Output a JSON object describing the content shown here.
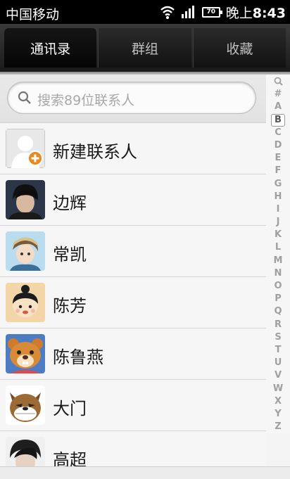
{
  "status_bar": {
    "carrier": "中国移动",
    "battery": "70",
    "time_prefix": "晚上",
    "time": "8:43"
  },
  "tabs": [
    {
      "label": "通讯录",
      "active": true
    },
    {
      "label": "群组",
      "active": false
    },
    {
      "label": "收藏",
      "active": false
    }
  ],
  "search": {
    "placeholder": "搜索89位联系人"
  },
  "contacts": [
    {
      "name": "新建联系人",
      "avatar": "add-contact-icon"
    },
    {
      "name": "边辉",
      "avatar": "photo-avatar"
    },
    {
      "name": "常凯",
      "avatar": "photo-avatar"
    },
    {
      "name": "陈芳",
      "avatar": "photo-avatar"
    },
    {
      "name": "陈鲁燕",
      "avatar": "photo-avatar"
    },
    {
      "name": "大门",
      "avatar": "photo-avatar"
    },
    {
      "name": "高超",
      "avatar": "photo-avatar"
    }
  ],
  "index_letters": [
    "Q",
    "#",
    "A",
    "B",
    "C",
    "D",
    "E",
    "F",
    "G",
    "H",
    "I",
    "J",
    "K",
    "L",
    "M",
    "N",
    "O",
    "P",
    "Q",
    "R",
    "S",
    "T",
    "U",
    "V",
    "W",
    "X",
    "Y",
    "Z"
  ],
  "index_selected": "B"
}
